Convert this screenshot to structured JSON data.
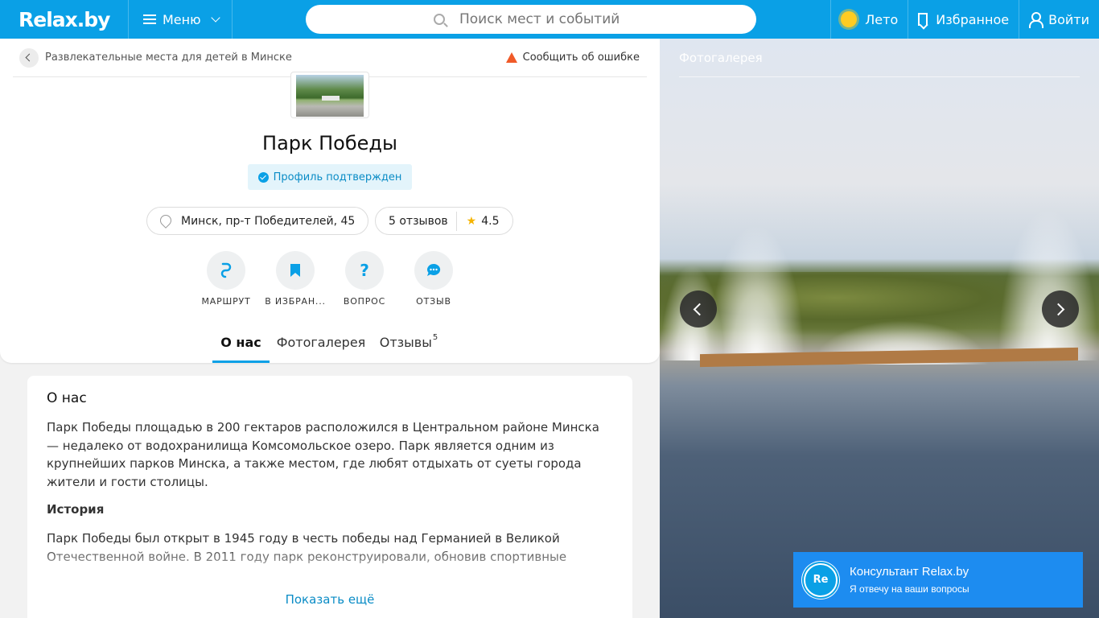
{
  "header": {
    "logo": "Relax.by",
    "menu_label": "Меню",
    "search_placeholder": "Поиск мест и событий",
    "season_label": "Лето",
    "favorites_label": "Избранное",
    "login_label": "Войти"
  },
  "breadcrumb": {
    "text": "Развлекательные места для детей в Минске",
    "report_label": "Сообщить об ошибке"
  },
  "place": {
    "title": "Парк Победы",
    "verified_label": "Профиль подтвержден",
    "address": "Минск, пр-т Победителей, 45",
    "reviews_label": "5 отзывов",
    "rating": "4.5"
  },
  "actions": [
    {
      "label": "МАРШРУТ",
      "icon": "route-icon"
    },
    {
      "label": "В ИЗБРАН...",
      "icon": "bookmark-icon"
    },
    {
      "label": "ВОПРОС",
      "icon": "question-icon"
    },
    {
      "label": "ОТЗЫВ",
      "icon": "chat-icon"
    }
  ],
  "tabs": {
    "about": "О нас",
    "gallery": "Фотогалерея",
    "reviews": "Отзывы",
    "reviews_count": "5"
  },
  "about": {
    "heading": "О нас",
    "paragraph1": "Парк Победы площадью в 200 гектаров расположился в Центральном районе Минска — недалеко от водохранилища Комсомольское озеро. Парк является одним из крупнейших парков Минска, а также местом, где любят отдыхать от суеты города жители и гости столицы.",
    "history_heading": "История",
    "paragraph2": "Парк Победы был открыт в 1945 году в честь победы над Германией в Великой Отечественной войне. В 2011 году парк реконструировали, обновив спортивные",
    "show_more": "Показать ещё"
  },
  "gallery": {
    "heading": "Фотогалерея"
  },
  "consultant": {
    "avatar_text": "Re",
    "title": "Консультант Relax.by",
    "subtitle": "Я отвечу на ваши вопросы"
  },
  "colors": {
    "brand": "#0aa0e6",
    "consultant_bg": "#1d8cf0",
    "rating_star": "#f5b400",
    "warning": "#f05a28"
  }
}
